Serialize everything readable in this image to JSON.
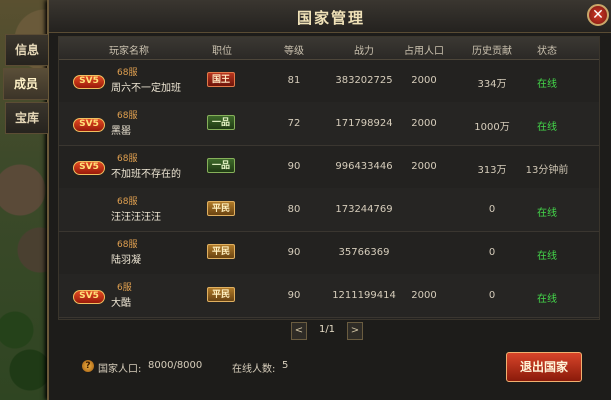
{
  "window": {
    "title": "国家管理",
    "close_icon": "close-icon"
  },
  "sidebar": {
    "tabs": [
      {
        "label": "信息",
        "active": false
      },
      {
        "label": "成员",
        "active": true
      },
      {
        "label": "宝库",
        "active": false
      }
    ]
  },
  "table": {
    "headers": [
      "玩家名称",
      "职位",
      "等级",
      "战力",
      "占用人口",
      "历史贡献",
      "状态"
    ],
    "rows": [
      {
        "sv": "SV5",
        "server": "68服",
        "name": "周六不一定加班",
        "rank": "国王",
        "rank_type": "king",
        "level": "81",
        "power": "383202725",
        "population": "2000",
        "contribution": "334万",
        "status": "在线",
        "online": true
      },
      {
        "sv": "SV5",
        "server": "68服",
        "name": "黑罂",
        "rank": "一品",
        "rank_type": "first",
        "level": "72",
        "power": "171798924",
        "population": "2000",
        "contribution": "1000万",
        "status": "在线",
        "online": true
      },
      {
        "sv": "SV5",
        "server": "68服",
        "name": "不加班不存在的",
        "rank": "一品",
        "rank_type": "first",
        "level": "90",
        "power": "996433446",
        "population": "2000",
        "contribution": "313万",
        "status": "13分钟前",
        "online": false
      },
      {
        "sv": "",
        "server": "68服",
        "name": "汪汪汪汪汪",
        "rank": "平民",
        "rank_type": "commoner",
        "level": "80",
        "power": "173244769",
        "population": "",
        "contribution": "0",
        "status": "在线",
        "online": true
      },
      {
        "sv": "",
        "server": "68服",
        "name": "陆羽凝",
        "rank": "平民",
        "rank_type": "commoner",
        "level": "90",
        "power": "35766369",
        "population": "",
        "contribution": "0",
        "status": "在线",
        "online": true
      },
      {
        "sv": "SV5",
        "server": "6服",
        "name": "大酷",
        "rank": "平民",
        "rank_type": "commoner",
        "level": "90",
        "power": "1211199414",
        "population": "2000",
        "contribution": "0",
        "status": "在线",
        "online": true
      }
    ]
  },
  "pager": {
    "prev": "<",
    "page": "1/1",
    "next": ">"
  },
  "footer": {
    "info_icon": "?",
    "population_label": "国家人口:",
    "population_value": "8000/8000",
    "online_label": "在线人数:",
    "online_value": "5",
    "exit_label": "退出国家"
  },
  "colors": {
    "online": "#44d84a",
    "king": "#b8351e",
    "first": "#3e6a2a",
    "commoner": "#b07a28",
    "exit": "#d8452a"
  }
}
